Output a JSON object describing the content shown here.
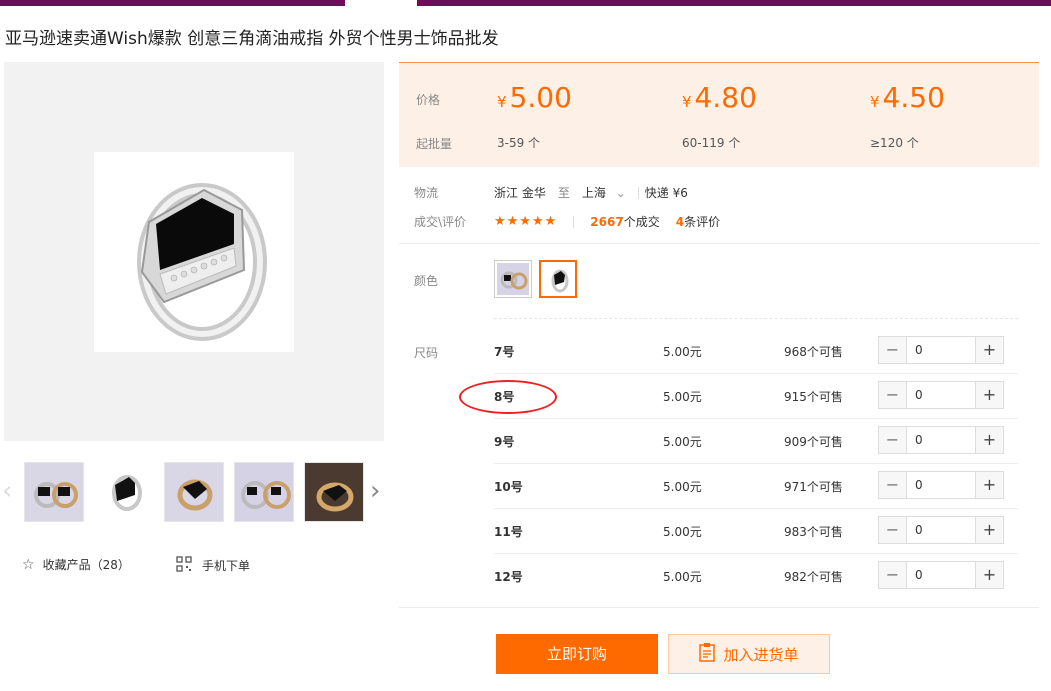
{
  "product": {
    "title": "亚马逊速卖通Wish爆款 创意三角滴油戒指 外贸个性男士饰品批发"
  },
  "gallery": {
    "thumbnails": [
      "两枚戒指",
      "黑银戒指",
      "金色戒指",
      "银金戒指",
      "黑金戒指"
    ],
    "favorite_label": "收藏产品（28）",
    "mobile_label": "手机下单"
  },
  "price": {
    "price_label": "价格",
    "min_qty_label": "起批量",
    "currency": "¥",
    "tiers": [
      {
        "price": "5.00",
        "qty": "3-59 个"
      },
      {
        "price": "4.80",
        "qty": "60-119 个"
      },
      {
        "price": "4.50",
        "qty": "≥120 个"
      }
    ]
  },
  "logistics": {
    "label": "物流",
    "from": "浙江 金华",
    "to_word": "至",
    "to": "上海",
    "shipping": "快递 ¥6"
  },
  "deals": {
    "label": "成交\\评价",
    "stars": "★★★★★",
    "deal_count": "2667",
    "deal_unit": "个成交",
    "review_count": "4",
    "review_unit": "条评价"
  },
  "color": {
    "label": "颜色",
    "selected_index": 1
  },
  "sizes": {
    "label": "尺码",
    "rows": [
      {
        "name": "7号",
        "price": "5.00元",
        "stock": "968个可售",
        "qty": "0"
      },
      {
        "name": "8号",
        "price": "5.00元",
        "stock": "915个可售",
        "qty": "0"
      },
      {
        "name": "9号",
        "price": "5.00元",
        "stock": "909个可售",
        "qty": "0"
      },
      {
        "name": "10号",
        "price": "5.00元",
        "stock": "971个可售",
        "qty": "0"
      },
      {
        "name": "11号",
        "price": "5.00元",
        "stock": "983个可售",
        "qty": "0"
      },
      {
        "name": "12号",
        "price": "5.00元",
        "stock": "982个可售",
        "qty": "0"
      }
    ],
    "minus": "−",
    "plus": "+"
  },
  "actions": {
    "buy_label": "立即订购",
    "cart_label": "加入进货单"
  },
  "colors": {
    "accent": "#ff6a00",
    "top_bar": "#6b0f5b",
    "annotation": "#e22222"
  }
}
